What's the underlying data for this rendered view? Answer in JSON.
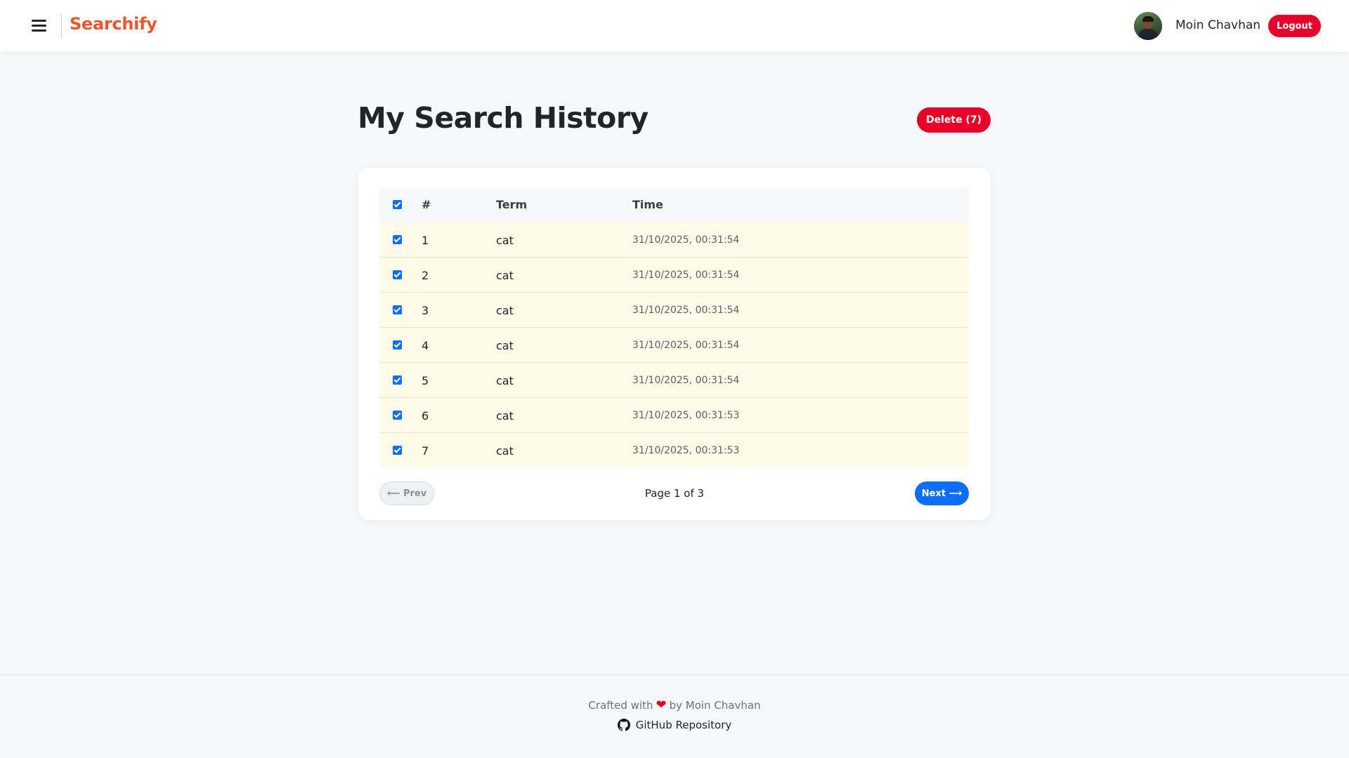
{
  "header": {
    "brand": "Searchify",
    "user_name": "Moin Chavhan",
    "logout_label": "Logout"
  },
  "main": {
    "title": "My Search History",
    "delete_label": "Delete (7)",
    "table": {
      "columns": [
        "#",
        "Term",
        "Time"
      ],
      "rows": [
        {
          "num": "1",
          "term": "cat",
          "time": "31/10/2025, 00:31:54",
          "checked": true
        },
        {
          "num": "2",
          "term": "cat",
          "time": "31/10/2025, 00:31:54",
          "checked": true
        },
        {
          "num": "3",
          "term": "cat",
          "time": "31/10/2025, 00:31:54",
          "checked": true
        },
        {
          "num": "4",
          "term": "cat",
          "time": "31/10/2025, 00:31:54",
          "checked": true
        },
        {
          "num": "5",
          "term": "cat",
          "time": "31/10/2025, 00:31:54",
          "checked": true
        },
        {
          "num": "6",
          "term": "cat",
          "time": "31/10/2025, 00:31:53",
          "checked": true
        },
        {
          "num": "7",
          "term": "cat",
          "time": "31/10/2025, 00:31:53",
          "checked": true
        }
      ]
    },
    "pagination": {
      "prev_label": "⟵ Prev",
      "page_info": "Page 1 of 3",
      "next_label": "Next ⟶"
    }
  },
  "footer": {
    "crafted_prefix": "Crafted with",
    "heart": "❤",
    "crafted_suffix": "by Moin Chavhan",
    "repo_label": "GitHub Repository"
  },
  "colors": {
    "brand": "#f0532e",
    "danger": "#e8002b",
    "primary": "#0b6ef5",
    "row_highlight": "#fffbe8"
  }
}
